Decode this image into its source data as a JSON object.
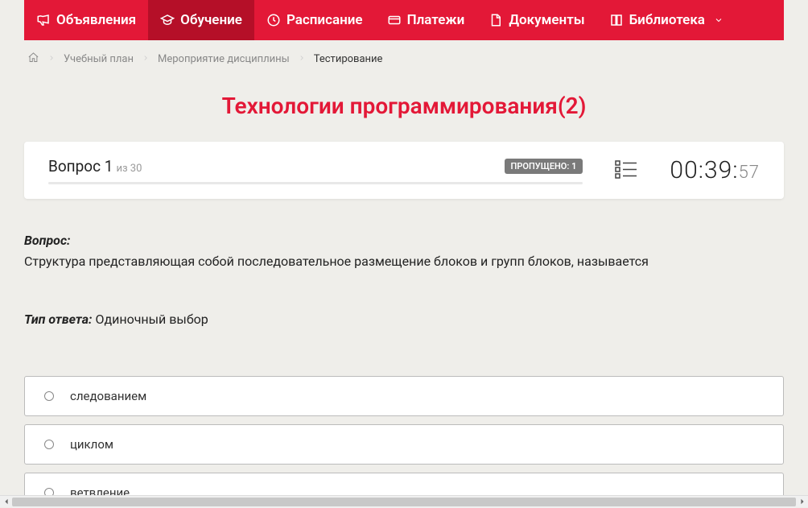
{
  "nav": {
    "items": [
      {
        "label": "Объявления",
        "icon": "megaphone"
      },
      {
        "label": "Обучение",
        "icon": "grad-cap",
        "active": true
      },
      {
        "label": "Расписание",
        "icon": "clock"
      },
      {
        "label": "Платежи",
        "icon": "card"
      },
      {
        "label": "Документы",
        "icon": "doc"
      },
      {
        "label": "Библиотека",
        "icon": "book",
        "has_dropdown": true
      }
    ]
  },
  "breadcrumb": {
    "items": [
      {
        "label": "Учебный план"
      },
      {
        "label": "Мероприятие дисциплины"
      }
    ],
    "current": "Тестирование"
  },
  "page_title": "Технологии программирования(2)",
  "question_header": {
    "question_label": "Вопрос 1",
    "total_label": "из 30",
    "skipped_label": "ПРОПУЩЕНО: 1",
    "timer_main": "00:39:",
    "timer_seconds": "57"
  },
  "question": {
    "label": "Вопрос:",
    "text": "Структура представляющая собой последовательное размещение блоков и групп блоков, называется",
    "answer_type_label": "Тип ответа:",
    "answer_type_value": " Одиночный выбор"
  },
  "answers": [
    {
      "text": "следованием"
    },
    {
      "text": "циклом"
    },
    {
      "text": "ветвление"
    }
  ]
}
